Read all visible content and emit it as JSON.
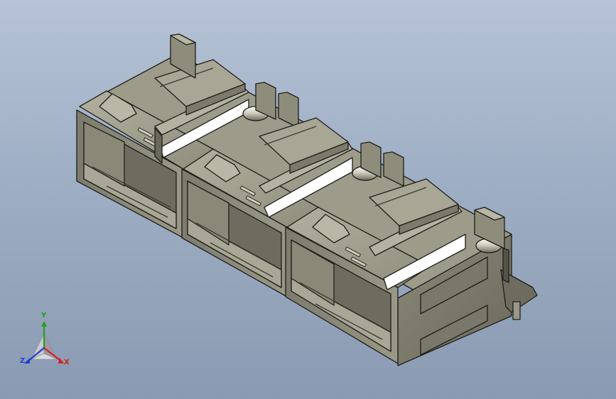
{
  "viewport": {
    "colors": {
      "background_top": "#b6c3d6",
      "background_bottom": "#8a9ab2",
      "body": "#8c8a7a",
      "body_light": "#a6a493",
      "body_dark": "#5d5b4f",
      "edge": "#1e1e1a",
      "highlight": "#ffffff"
    },
    "model": {
      "description_icon": "rj45-triple-connector-model",
      "port_count": 3
    }
  },
  "triad": {
    "x_label": "X",
    "y_label": "Y",
    "z_label": "Z",
    "colors": {
      "x": "#d42020",
      "y": "#20a020",
      "z": "#2040d0"
    }
  }
}
